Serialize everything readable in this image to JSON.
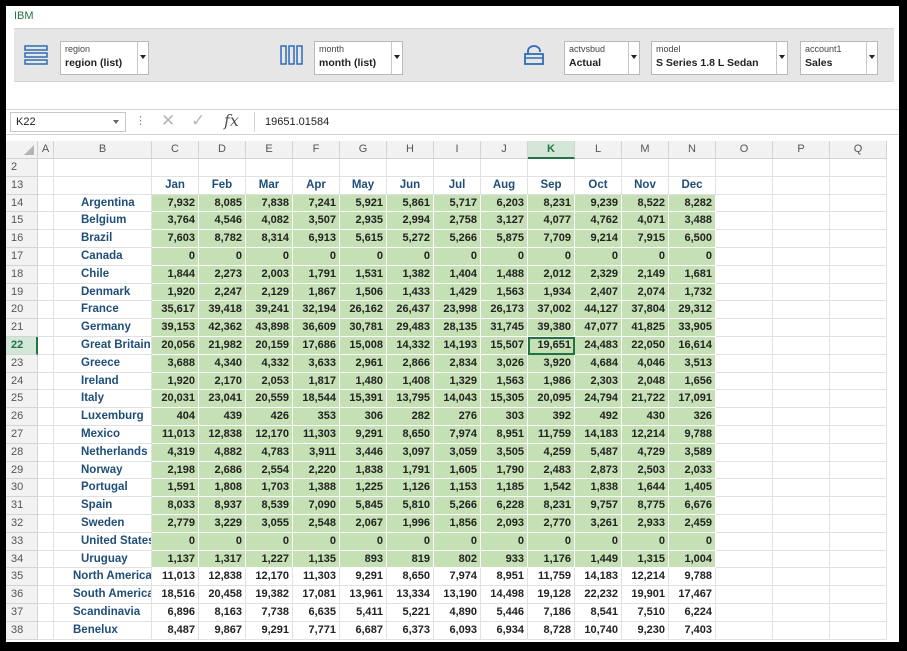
{
  "brand": "IBM",
  "toolbar": {
    "dims": [
      {
        "key": "region",
        "label": "region",
        "value": "region (list)",
        "icon": "hierarchy-list-icon"
      },
      {
        "key": "month",
        "label": "month",
        "value": "month (list)",
        "icon": "columns-icon"
      },
      {
        "key": "actvsbud",
        "label": "actvsbud",
        "value": "Actual",
        "icon": "lock-icon"
      },
      {
        "key": "model",
        "label": "model",
        "value": "S Series 1.8 L Sedan"
      },
      {
        "key": "account1",
        "label": "account1",
        "value": "Sales"
      }
    ]
  },
  "formula_bar": {
    "name_box": "K22",
    "formula": "19651.01584"
  },
  "columns": [
    "A",
    "B",
    "C",
    "D",
    "E",
    "F",
    "G",
    "H",
    "I",
    "J",
    "K",
    "L",
    "M",
    "N",
    "O",
    "P",
    "Q"
  ],
  "selected_column": "K",
  "selected_row": 22,
  "row_numbers": [
    2,
    13,
    14,
    15,
    16,
    17,
    18,
    19,
    20,
    21,
    22,
    23,
    24,
    25,
    26,
    27,
    28,
    29,
    30,
    31,
    32,
    33,
    34,
    35,
    36,
    37,
    38
  ],
  "months": [
    "Jan",
    "Feb",
    "Mar",
    "Apr",
    "May",
    "Jun",
    "Jul",
    "Aug",
    "Sep",
    "Oct",
    "Nov",
    "Dec"
  ],
  "rows": [
    {
      "row": 14,
      "name": "Argentina",
      "values": [
        "7,932",
        "8,085",
        "7,838",
        "7,241",
        "5,921",
        "5,861",
        "5,717",
        "6,203",
        "8,231",
        "9,239",
        "8,522",
        "8,282"
      ],
      "green": true
    },
    {
      "row": 15,
      "name": "Belgium",
      "values": [
        "3,764",
        "4,546",
        "4,082",
        "3,507",
        "2,935",
        "2,994",
        "2,758",
        "3,127",
        "4,077",
        "4,762",
        "4,071",
        "3,488"
      ],
      "green": true
    },
    {
      "row": 16,
      "name": "Brazil",
      "values": [
        "7,603",
        "8,782",
        "8,314",
        "6,913",
        "5,615",
        "5,272",
        "5,266",
        "5,875",
        "7,709",
        "9,214",
        "7,915",
        "6,500"
      ],
      "green": true
    },
    {
      "row": 17,
      "name": "Canada",
      "values": [
        "0",
        "0",
        "0",
        "0",
        "0",
        "0",
        "0",
        "0",
        "0",
        "0",
        "0",
        "0"
      ],
      "green": true
    },
    {
      "row": 18,
      "name": "Chile",
      "values": [
        "1,844",
        "2,273",
        "2,003",
        "1,791",
        "1,531",
        "1,382",
        "1,404",
        "1,488",
        "2,012",
        "2,329",
        "2,149",
        "1,681"
      ],
      "green": true
    },
    {
      "row": 19,
      "name": "Denmark",
      "values": [
        "1,920",
        "2,247",
        "2,129",
        "1,867",
        "1,506",
        "1,433",
        "1,429",
        "1,563",
        "1,934",
        "2,407",
        "2,074",
        "1,732"
      ],
      "green": true
    },
    {
      "row": 20,
      "name": "France",
      "values": [
        "35,617",
        "39,418",
        "39,241",
        "32,194",
        "26,162",
        "26,437",
        "23,998",
        "26,173",
        "37,002",
        "44,127",
        "37,804",
        "29,312"
      ],
      "green": true
    },
    {
      "row": 21,
      "name": "Germany",
      "values": [
        "39,153",
        "42,362",
        "43,898",
        "36,609",
        "30,781",
        "29,483",
        "28,135",
        "31,745",
        "39,380",
        "47,077",
        "41,825",
        "33,905"
      ],
      "green": true
    },
    {
      "row": 22,
      "name": "Great Britain",
      "values": [
        "20,056",
        "21,982",
        "20,159",
        "17,686",
        "15,008",
        "14,332",
        "14,193",
        "15,507",
        "19,651",
        "24,483",
        "22,050",
        "16,614"
      ],
      "green": true
    },
    {
      "row": 23,
      "name": "Greece",
      "values": [
        "3,688",
        "4,340",
        "4,332",
        "3,633",
        "2,961",
        "2,866",
        "2,834",
        "3,026",
        "3,920",
        "4,684",
        "4,046",
        "3,513"
      ],
      "green": true
    },
    {
      "row": 24,
      "name": "Ireland",
      "values": [
        "1,920",
        "2,170",
        "2,053",
        "1,817",
        "1,480",
        "1,408",
        "1,329",
        "1,563",
        "1,986",
        "2,303",
        "2,048",
        "1,656"
      ],
      "green": true
    },
    {
      "row": 25,
      "name": "Italy",
      "values": [
        "20,031",
        "23,041",
        "20,559",
        "18,544",
        "15,391",
        "13,795",
        "14,043",
        "15,305",
        "20,095",
        "24,794",
        "21,722",
        "17,091"
      ],
      "green": true
    },
    {
      "row": 26,
      "name": "Luxemburg",
      "values": [
        "404",
        "439",
        "426",
        "353",
        "306",
        "282",
        "276",
        "303",
        "392",
        "492",
        "430",
        "326"
      ],
      "green": true
    },
    {
      "row": 27,
      "name": "Mexico",
      "values": [
        "11,013",
        "12,838",
        "12,170",
        "11,303",
        "9,291",
        "8,650",
        "7,974",
        "8,951",
        "11,759",
        "14,183",
        "12,214",
        "9,788"
      ],
      "green": true
    },
    {
      "row": 28,
      "name": "Netherlands",
      "values": [
        "4,319",
        "4,882",
        "4,783",
        "3,911",
        "3,446",
        "3,097",
        "3,059",
        "3,505",
        "4,259",
        "5,487",
        "4,729",
        "3,589"
      ],
      "green": true
    },
    {
      "row": 29,
      "name": "Norway",
      "values": [
        "2,198",
        "2,686",
        "2,554",
        "2,220",
        "1,838",
        "1,791",
        "1,605",
        "1,790",
        "2,483",
        "2,873",
        "2,503",
        "2,033"
      ],
      "green": true
    },
    {
      "row": 30,
      "name": "Portugal",
      "values": [
        "1,591",
        "1,808",
        "1,703",
        "1,388",
        "1,225",
        "1,126",
        "1,153",
        "1,185",
        "1,542",
        "1,838",
        "1,644",
        "1,405"
      ],
      "green": true
    },
    {
      "row": 31,
      "name": "Spain",
      "values": [
        "8,033",
        "8,937",
        "8,539",
        "7,090",
        "5,845",
        "5,810",
        "5,266",
        "6,228",
        "8,231",
        "9,757",
        "8,775",
        "6,676"
      ],
      "green": true
    },
    {
      "row": 32,
      "name": "Sweden",
      "values": [
        "2,779",
        "3,229",
        "3,055",
        "2,548",
        "2,067",
        "1,996",
        "1,856",
        "2,093",
        "2,770",
        "3,261",
        "2,933",
        "2,459"
      ],
      "green": true
    },
    {
      "row": 33,
      "name": "United States",
      "values": [
        "0",
        "0",
        "0",
        "0",
        "0",
        "0",
        "0",
        "0",
        "0",
        "0",
        "0",
        "0"
      ],
      "green": true
    },
    {
      "row": 34,
      "name": "Uruguay",
      "values": [
        "1,137",
        "1,317",
        "1,227",
        "1,135",
        "893",
        "819",
        "802",
        "933",
        "1,176",
        "1,449",
        "1,315",
        "1,004"
      ],
      "green": true
    },
    {
      "row": 35,
      "name": "North America",
      "values": [
        "11,013",
        "12,838",
        "12,170",
        "11,303",
        "9,291",
        "8,650",
        "7,974",
        "8,951",
        "11,759",
        "14,183",
        "12,214",
        "9,788"
      ],
      "green": false
    },
    {
      "row": 36,
      "name": "South America",
      "values": [
        "18,516",
        "20,458",
        "19,382",
        "17,081",
        "13,961",
        "13,334",
        "13,190",
        "14,498",
        "19,128",
        "22,232",
        "19,901",
        "17,467"
      ],
      "green": false
    },
    {
      "row": 37,
      "name": "Scandinavia",
      "values": [
        "6,896",
        "8,163",
        "7,738",
        "6,635",
        "5,411",
        "5,221",
        "4,890",
        "5,446",
        "7,186",
        "8,541",
        "7,510",
        "6,224"
      ],
      "green": false
    },
    {
      "row": 38,
      "name": "Benelux",
      "values": [
        "8,487",
        "9,867",
        "9,291",
        "7,771",
        "6,687",
        "6,373",
        "6,093",
        "6,934",
        "8,728",
        "10,740",
        "9,230",
        "7,403"
      ],
      "green": false
    }
  ]
}
